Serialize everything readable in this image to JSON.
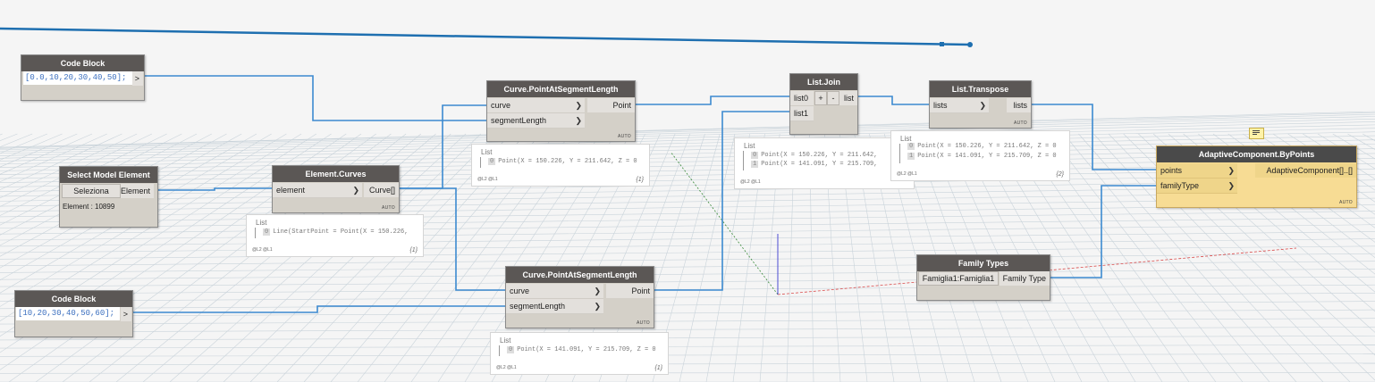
{
  "nodes": {
    "code_block_1": {
      "title": "Code Block",
      "code": "[0.0,10,20,30,40,50];",
      "output": ">"
    },
    "code_block_2": {
      "title": "Code Block",
      "code": "[10,20,30,40,50,60];",
      "output": ">"
    },
    "select_model_element": {
      "title": "Select Model Element",
      "button": "Seleziona",
      "output": "Element",
      "info": "Element : 10899"
    },
    "element_curves": {
      "title": "Element.Curves",
      "input": "element",
      "output": "Curve[]",
      "lacing": "AUTO"
    },
    "pt_seg_1": {
      "title": "Curve.PointAtSegmentLength",
      "inputs": [
        "curve",
        "segmentLength"
      ],
      "output": "Point",
      "lacing": "AUTO"
    },
    "pt_seg_2": {
      "title": "Curve.PointAtSegmentLength",
      "inputs": [
        "curve",
        "segmentLength"
      ],
      "output": "Point",
      "lacing": "AUTO"
    },
    "list_join": {
      "title": "List.Join",
      "inputs": [
        "list0",
        "list1"
      ],
      "plus": "+",
      "minus": "-",
      "output": "list"
    },
    "list_transpose": {
      "title": "List.Transpose",
      "input": "lists",
      "output": "lists",
      "lacing": "AUTO"
    },
    "family_types": {
      "title": "Family Types",
      "selected": "Famiglia1:Famiglia1",
      "output": "Family Type"
    },
    "adaptive": {
      "title": "AdaptiveComponent.ByPoints",
      "inputs": [
        "points",
        "familyType"
      ],
      "output": "AdaptiveComponent[]..[]",
      "lacing": "AUTO"
    }
  },
  "previews": {
    "curves": {
      "title": "List",
      "rows": [
        {
          "i": "0",
          "text": "Line(StartPoint = Point(X = 150.226,"
        }
      ],
      "levels": "@L2 @L1",
      "count": "{1}"
    },
    "pt1": {
      "title": "List",
      "rows": [
        {
          "i": "0",
          "text": "Point(X = 150.226, Y = 211.642, Z = 0"
        }
      ],
      "levels": "@L2 @L1",
      "count": "{1}"
    },
    "pt2": {
      "title": "List",
      "rows": [
        {
          "i": "0",
          "text": "Point(X = 141.091, Y = 215.709, Z = 0"
        }
      ],
      "levels": "@L2 @L1",
      "count": "{1}"
    },
    "join": {
      "title": "List",
      "rows": [
        {
          "i": "0",
          "text": "Point(X = 150.226, Y = 211.642,"
        },
        {
          "i": "1",
          "text": "Point(X = 141.091, Y = 215.709,"
        }
      ],
      "levels": "@L2 @L1",
      "count": ""
    },
    "transpose": {
      "title": "List",
      "rows": [
        {
          "i": "0",
          "text": "Point(X = 150.226, Y = 211.642, Z = 0"
        },
        {
          "i": "1",
          "text": "Point(X = 141.091, Y = 215.709, Z = 0"
        }
      ],
      "levels": "@L2 @L1",
      "count": "{2}"
    }
  },
  "colors": {
    "wire": "#3c8ad0",
    "header": "#5b5755",
    "adaptive_body": "#f7dc94",
    "grid": "#c9d3da"
  }
}
